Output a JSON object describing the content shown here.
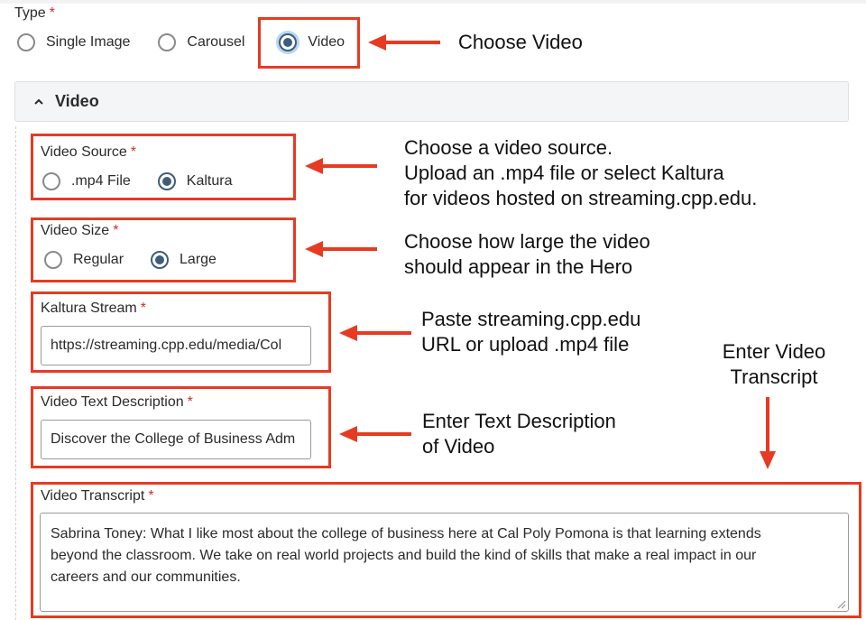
{
  "type_field": {
    "label": "Type",
    "required_mark": "*",
    "options": [
      "Single Image",
      "Carousel",
      "Video"
    ],
    "selected": "Video"
  },
  "video_section": {
    "title": "Video",
    "video_source": {
      "label": "Video Source",
      "required_mark": "*",
      "options": [
        ".mp4 File",
        "Kaltura"
      ],
      "selected": "Kaltura"
    },
    "video_size": {
      "label": "Video Size",
      "required_mark": "*",
      "options": [
        "Regular",
        "Large"
      ],
      "selected": "Large"
    },
    "kaltura_stream": {
      "label": "Kaltura Stream",
      "required_mark": "*",
      "value": "https://streaming.cpp.edu/media/Col"
    },
    "video_text_description": {
      "label": "Video Text Description",
      "required_mark": "*",
      "value": "Discover the College of Business Adm"
    },
    "video_transcript": {
      "label": "Video Transcript",
      "required_mark": "*",
      "lines": [
        "Sabrina Toney: What I like most about the college of business here at Cal Poly Pomona is that learning extends",
        "beyond the classroom. We take on real world projects and build the kind of skills that make a real impact in our",
        "careers and our communities."
      ]
    }
  },
  "annotations": {
    "choose_video": "Choose Video",
    "video_source_note": [
      "Choose a video source.",
      "Upload an .mp4 file or select Kaltura",
      "for videos hosted on streaming.cpp.edu."
    ],
    "video_size_note": [
      "Choose how large the video",
      "should appear in the Hero"
    ],
    "kaltura_note": [
      "Paste streaming.cpp.edu",
      "URL or upload .mp4 file"
    ],
    "description_note": [
      "Enter Text Description",
      "of Video"
    ],
    "transcript_note": [
      "Enter Video",
      "Transcript"
    ]
  },
  "colors": {
    "highlight": "#e63b22",
    "radio_checked": "#3f5d7a",
    "required": "#c9302c"
  }
}
